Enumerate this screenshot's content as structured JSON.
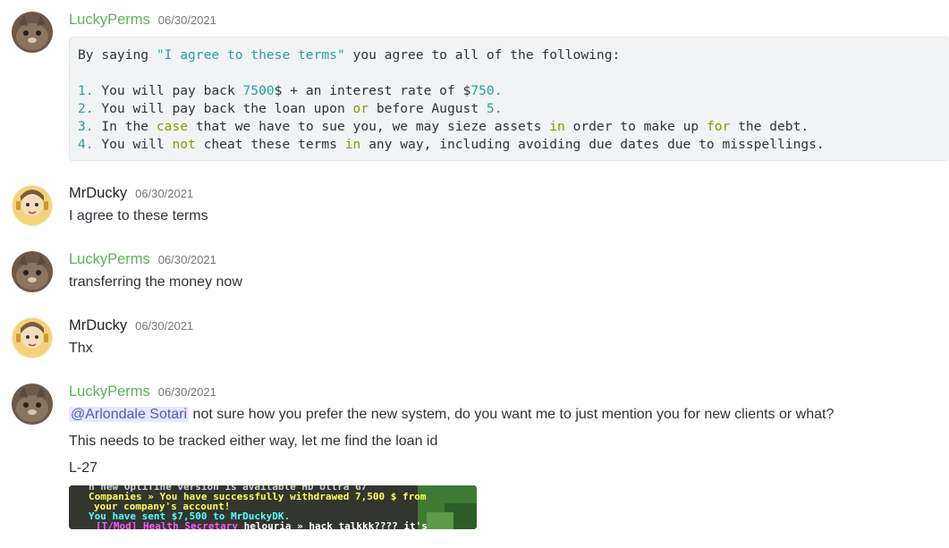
{
  "messages": [
    {
      "author": "LuckyPerms",
      "timestamp": "06/30/2021",
      "code": {
        "line1": {
          "a": "By saying ",
          "b": "\"I agree to these terms\"",
          "c": " you agree to all of the following:"
        },
        "item1": {
          "n": "1.",
          "a": " You will pay back ",
          "b": "7500",
          "c": "$ + an interest rate of $",
          "d": "750",
          "e": "."
        },
        "item2": {
          "n": "2.",
          "a": " You will pay back the loan upon ",
          "b": "or",
          "c": " before August ",
          "d": "5",
          "e": "."
        },
        "item3": {
          "n": "3.",
          "a": " In the ",
          "b": "case",
          "c": " that we have to sue you, we may sieze assets ",
          "d": "in",
          "e": " order to make up ",
          "f": "for",
          "g": " the debt."
        },
        "item4": {
          "n": "4.",
          "a": " You will ",
          "b": "not",
          "c": " cheat these terms ",
          "d": "in",
          "e": " any way, including avoiding due dates due to misspellings."
        }
      }
    },
    {
      "author": "MrDucky",
      "timestamp": "06/30/2021",
      "text": "I agree to these terms"
    },
    {
      "author": "LuckyPerms",
      "timestamp": "06/30/2021",
      "text": "transferring the money now"
    },
    {
      "author": "MrDucky",
      "timestamp": "06/30/2021",
      "text": "Thx"
    },
    {
      "author": "LuckyPerms",
      "timestamp": "06/30/2021",
      "mention": "@Arlondale Sotari",
      "text1": " not sure how you prefer the new system, do you want me to just mention you for new clients or what?",
      "text2": "This needs to be tracked either way, let me find the loan id",
      "text3": "L-27",
      "attachment": {
        "line0": "h new Optifine version is available HD Ultra G7",
        "line1a": "Companies",
        "line1b": " » You have successfully withdrawed 7,500 $ from",
        "line2": "your company's account!",
        "line3": "You have sent $7,500 to MrDuckyDK.",
        "line4a": "[T/Mod] Health Secretary",
        "line4b": " helouria » hack talkkk???? it's"
      }
    }
  ],
  "colors": {
    "lucky": "#5ab35a",
    "mention_bg": "#e6e8fd",
    "code_bg": "#f2f3f5"
  }
}
